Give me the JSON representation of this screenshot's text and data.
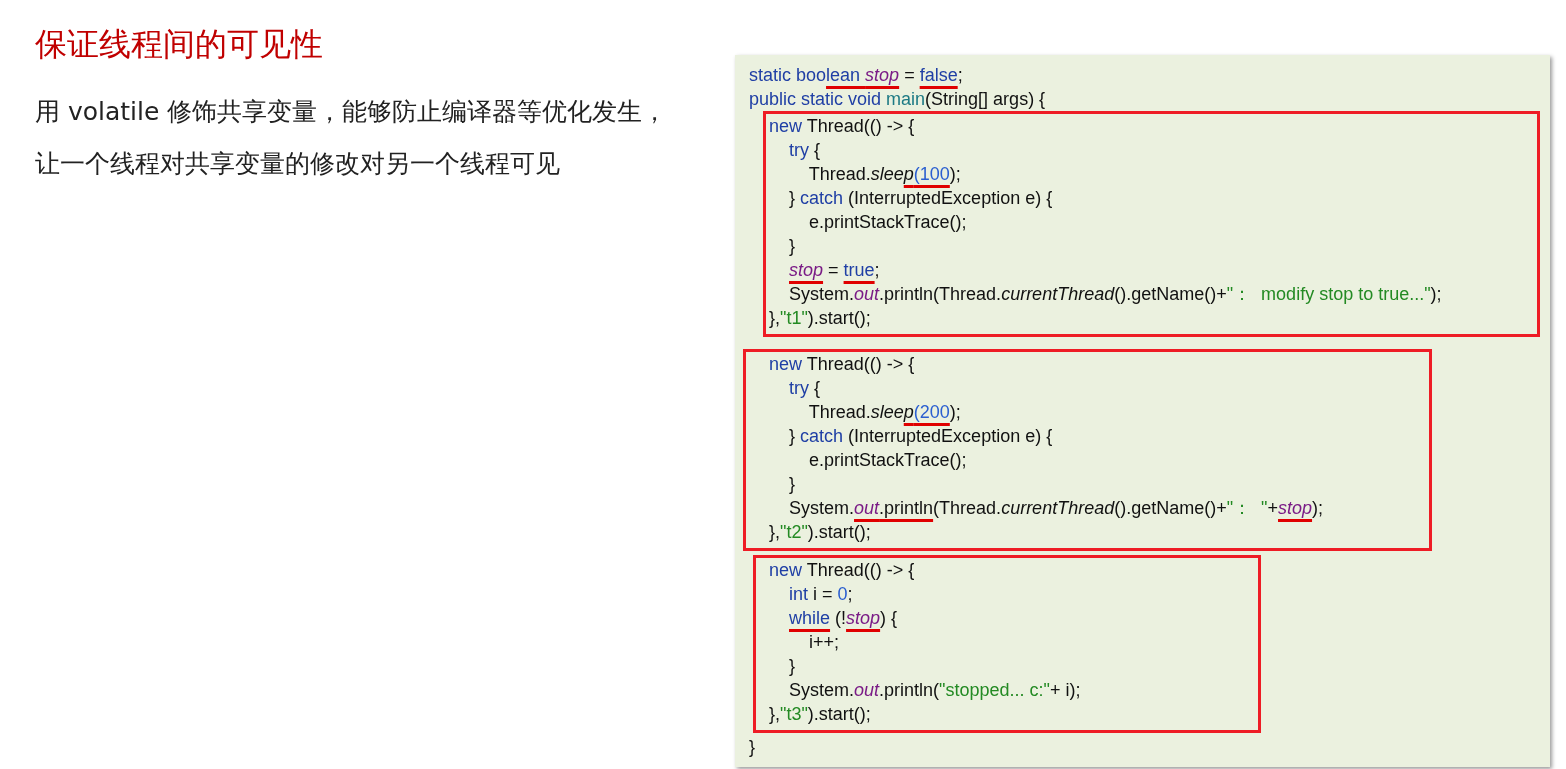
{
  "title": "保证线程间的可见性",
  "description": "用 volatile 修饰共享变量，能够防止编译器等优化发生，让一个线程对共享变量的修改对另一个线程可见",
  "code": {
    "lines_before": [
      [
        {
          "kind": "kw",
          "t": "static boo"
        },
        {
          "kind": "kw",
          "t": "lean ",
          "u": true
        },
        {
          "kind": "field",
          "t": "stop",
          "u": true
        },
        {
          "kind": "plain",
          "t": " = "
        },
        {
          "kind": "kw",
          "t": "false",
          "u": true
        },
        {
          "kind": "plain",
          "t": ";"
        }
      ],
      [
        {
          "kind": "kw",
          "t": "public static void "
        },
        {
          "kind": "fn",
          "t": "main"
        },
        {
          "kind": "plain",
          "t": "(String[] args) {"
        }
      ]
    ],
    "boxes": [
      {
        "lines": [
          [
            {
              "kind": "kw",
              "t": "    new "
            },
            {
              "kind": "plain",
              "t": "Thread(() -> {"
            }
          ],
          [
            {
              "kind": "kw",
              "t": "        try "
            },
            {
              "kind": "plain",
              "t": "{"
            }
          ],
          [
            {
              "kind": "plain",
              "t": "            Thread."
            },
            {
              "kind": "it",
              "t": "slee"
            },
            {
              "kind": "it",
              "t": "p",
              "u": true
            },
            {
              "kind": "num",
              "t": "(100",
              "u": true
            },
            {
              "kind": "plain",
              "t": ");"
            }
          ],
          [
            {
              "kind": "plain",
              "t": "        } "
            },
            {
              "kind": "kw",
              "t": "catch "
            },
            {
              "kind": "plain",
              "t": "(InterruptedException e) {"
            }
          ],
          [
            {
              "kind": "plain",
              "t": "            e.printStackTrace();"
            }
          ],
          [
            {
              "kind": "plain",
              "t": "        }"
            }
          ],
          [
            {
              "kind": "field",
              "t": "        stop",
              "u": true
            },
            {
              "kind": "plain",
              "t": " = "
            },
            {
              "kind": "kw",
              "t": "true",
              "u": true
            },
            {
              "kind": "plain",
              "t": ";"
            }
          ],
          [
            {
              "kind": "plain",
              "t": "        System."
            },
            {
              "kind": "field",
              "t": "out"
            },
            {
              "kind": "plain",
              "t": ".println(Thread."
            },
            {
              "kind": "it",
              "t": "currentThread"
            },
            {
              "kind": "plain",
              "t": "().getName()+"
            },
            {
              "kind": "str",
              "t": "\"：  modify stop to true...\""
            },
            {
              "kind": "plain",
              "t": ");"
            }
          ],
          [
            {
              "kind": "plain",
              "t": "    },"
            },
            {
              "kind": "str",
              "t": "\"t1\""
            },
            {
              "kind": "plain",
              "t": ").start();"
            }
          ]
        ]
      },
      {
        "lines": [
          [
            {
              "kind": "kw",
              "t": "    new "
            },
            {
              "kind": "plain",
              "t": "Thread(() -> {"
            }
          ],
          [
            {
              "kind": "kw",
              "t": "        try "
            },
            {
              "kind": "plain",
              "t": "{"
            }
          ],
          [
            {
              "kind": "plain",
              "t": "            Thread."
            },
            {
              "kind": "it",
              "t": "slee"
            },
            {
              "kind": "it",
              "t": "p",
              "u": true
            },
            {
              "kind": "num",
              "t": "(200",
              "u": true
            },
            {
              "kind": "plain",
              "t": ");"
            }
          ],
          [
            {
              "kind": "plain",
              "t": "        } "
            },
            {
              "kind": "kw",
              "t": "catch "
            },
            {
              "kind": "plain",
              "t": "(InterruptedException e) {"
            }
          ],
          [
            {
              "kind": "plain",
              "t": "            e.printStackTrace();"
            }
          ],
          [
            {
              "kind": "plain",
              "t": "        }"
            }
          ],
          [
            {
              "kind": "plain",
              "t": "        System."
            },
            {
              "kind": "field",
              "t": "out",
              "u": true
            },
            {
              "kind": "plain",
              "t": ".println",
              "u": true
            },
            {
              "kind": "plain",
              "t": "(Thread."
            },
            {
              "kind": "it",
              "t": "currentThread"
            },
            {
              "kind": "plain",
              "t": "().getName()+"
            },
            {
              "kind": "str",
              "t": "\"：  \""
            },
            {
              "kind": "plain",
              "t": "+"
            },
            {
              "kind": "field",
              "t": "stop",
              "u": true
            },
            {
              "kind": "plain",
              "t": ");"
            }
          ],
          [
            {
              "kind": "plain",
              "t": "    },"
            },
            {
              "kind": "str",
              "t": "\"t2\""
            },
            {
              "kind": "plain",
              "t": ").start();"
            }
          ]
        ]
      },
      {
        "lines": [
          [
            {
              "kind": "kw",
              "t": "    new "
            },
            {
              "kind": "plain",
              "t": "Thread(() -> {"
            }
          ],
          [
            {
              "kind": "kw",
              "t": "        int "
            },
            {
              "kind": "plain",
              "t": "i = "
            },
            {
              "kind": "num",
              "t": "0"
            },
            {
              "kind": "plain",
              "t": ";"
            }
          ],
          [
            {
              "kind": "kw",
              "t": "        while",
              "u": true
            },
            {
              "kind": "plain",
              "t": " (!"
            },
            {
              "kind": "field",
              "t": "stop",
              "u": true
            },
            {
              "kind": "plain",
              "t": ") {"
            }
          ],
          [
            {
              "kind": "plain",
              "t": "            i++;"
            }
          ],
          [
            {
              "kind": "plain",
              "t": "        }"
            }
          ],
          [
            {
              "kind": "plain",
              "t": "        System."
            },
            {
              "kind": "field",
              "t": "out"
            },
            {
              "kind": "plain",
              "t": ".println("
            },
            {
              "kind": "str",
              "t": "\"stopped... c:\""
            },
            {
              "kind": "plain",
              "t": "+ i);"
            }
          ],
          [
            {
              "kind": "plain",
              "t": "    },"
            },
            {
              "kind": "str",
              "t": "\"t3\""
            },
            {
              "kind": "plain",
              "t": ").start();"
            }
          ]
        ]
      }
    ],
    "lines_after": [
      [
        {
          "kind": "plain",
          "t": "}"
        }
      ]
    ]
  }
}
